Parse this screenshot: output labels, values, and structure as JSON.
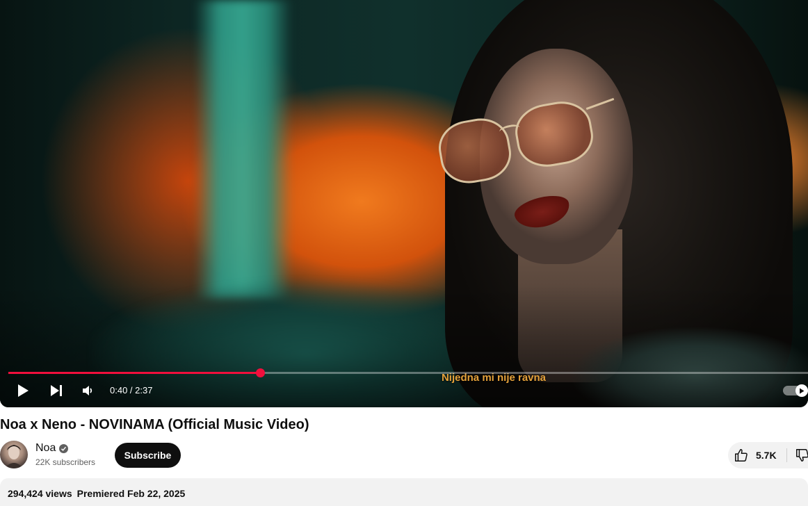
{
  "player": {
    "caption": "Nijedna mi nije ravna",
    "time_display": "0:40 / 2:37",
    "progress_fraction": 0.315,
    "progress_color": "#f00f3c",
    "autoplay": true
  },
  "video": {
    "title": "Noa x Neno - NOVINAMA (Official Music Video)"
  },
  "channel": {
    "name": "Noa",
    "subscribers": "22K subscribers",
    "verified": true,
    "subscribe_label": "Subscribe"
  },
  "actions": {
    "likes": "5.7K"
  },
  "description": {
    "views": "294,424 views",
    "premiered": "Premiered Feb 22, 2025"
  },
  "icons": [
    "play-icon",
    "next-icon",
    "volume-icon",
    "autoplay-icon",
    "verified-icon",
    "like-icon",
    "dislike-icon"
  ]
}
